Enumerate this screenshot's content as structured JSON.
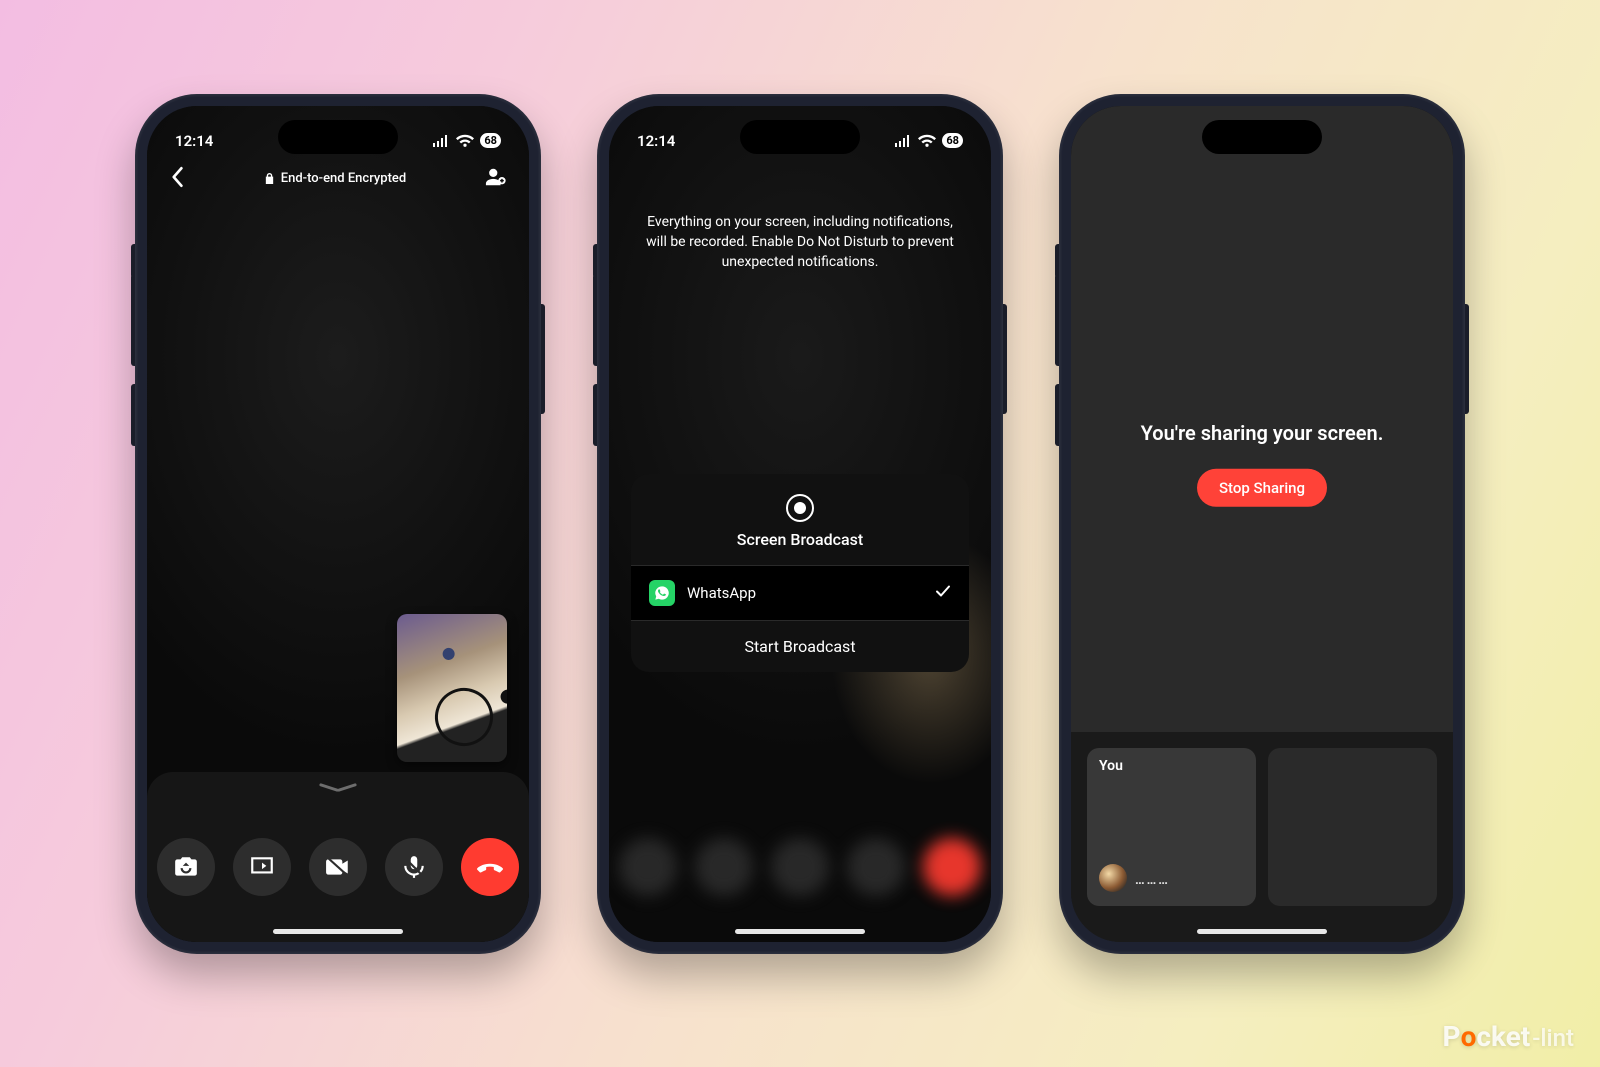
{
  "status": {
    "time": "12:14",
    "battery": "68"
  },
  "phone1": {
    "header_title": "End-to-end Encrypted"
  },
  "phone2": {
    "warning": "Everything on your screen, including notifications, will be recorded. Enable Do Not Disturb to prevent unexpected notifications.",
    "sheet_title": "Screen Broadcast",
    "app_name": "WhatsApp",
    "start_label": "Start Broadcast"
  },
  "phone3": {
    "sharing_msg": "You're sharing your screen.",
    "stop_label": "Stop Sharing",
    "you_label": "You",
    "dots": "………"
  },
  "watermark": {
    "brand_p": "P",
    "brand_o": "o",
    "brand_rest": "cket",
    "suffix": "-lint"
  }
}
